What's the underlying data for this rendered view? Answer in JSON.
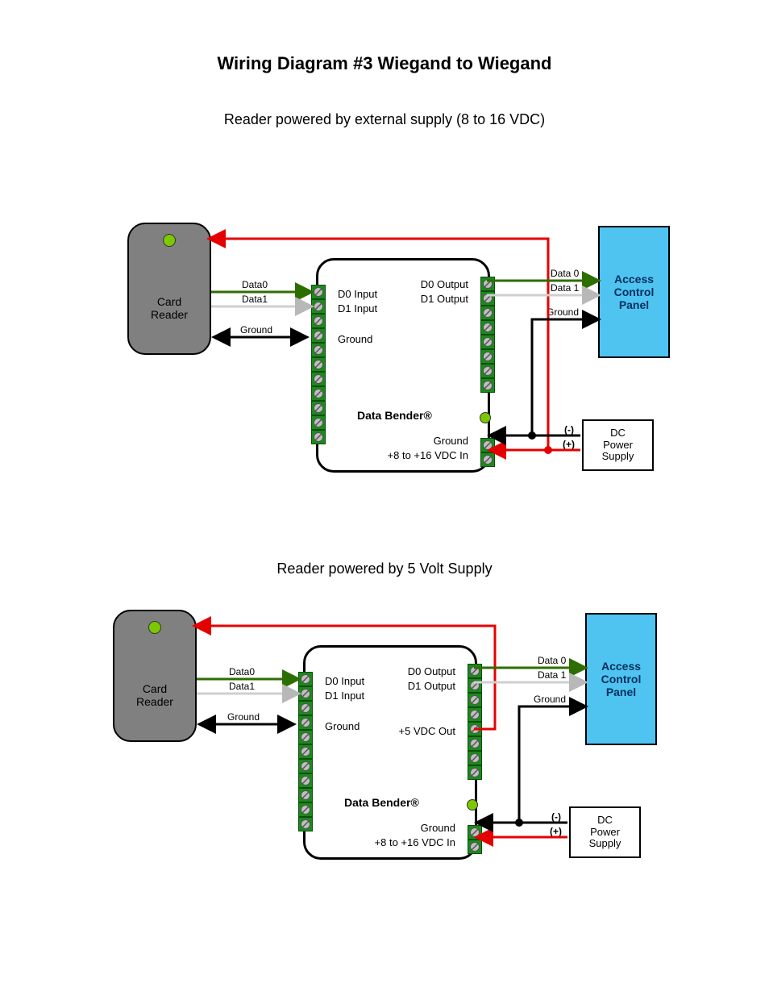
{
  "title": "Wiring Diagram #3 Wiegand to Wiegand",
  "diagram1": {
    "subtitle": "Reader powered by external supply (8 to 16 VDC)",
    "card_reader": "Card\nReader",
    "access_panel": "Access\nControl\nPanel",
    "psu": "DC\nPower\nSupply",
    "bender": "Data Bender®",
    "left_labels": {
      "d0": "D0 Input",
      "d1": "D1 Input",
      "gnd": "Ground"
    },
    "right_labels": {
      "d0": "D0 Output",
      "d1": "D1 Output",
      "gnd": "Ground",
      "vin": "+8 to +16 VDC In"
    },
    "wire_left": {
      "d0": "Data0",
      "d1": "Data1",
      "gnd": "Ground"
    },
    "wire_right": {
      "d0": "Data 0",
      "d1": "Data 1",
      "gnd": "Ground"
    },
    "psu_signs": {
      "neg": "(-)",
      "pos": "(+)"
    }
  },
  "diagram2": {
    "subtitle": "Reader powered by 5 Volt Supply",
    "card_reader": "Card\nReader",
    "access_panel": "Access\nControl\nPanel",
    "psu": "DC\nPower\nSupply",
    "bender": "Data Bender®",
    "left_labels": {
      "d0": "D0 Input",
      "d1": "D1 Input",
      "gnd": "Ground"
    },
    "right_labels": {
      "d0": "D0 Output",
      "d1": "D1 Output",
      "v5": "+5 VDC Out",
      "gnd": "Ground",
      "vin": "+8 to +16 VDC In"
    },
    "wire_left": {
      "d0": "Data0",
      "d1": "Data1",
      "gnd": "Ground"
    },
    "wire_right": {
      "d0": "Data 0",
      "d1": "Data 1",
      "gnd": "Ground"
    },
    "psu_signs": {
      "neg": "(-)",
      "pos": "(+)"
    }
  },
  "colors": {
    "red": "#e50000",
    "darkgreen": "#2d6e00",
    "grey": "#cfcfcf",
    "black": "#000000"
  }
}
